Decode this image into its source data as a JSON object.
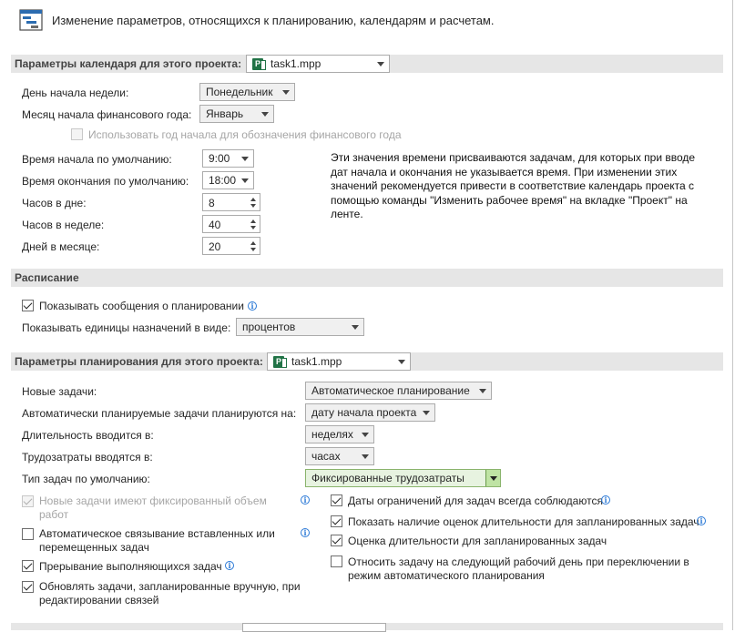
{
  "header": {
    "text": "Изменение параметров, относящихся к планированию, календарям и расчетам.",
    "icon": "schedule-icon"
  },
  "calendar": {
    "title": "Параметры календаря для этого проекта:",
    "project": "task1.mpp",
    "week_start_label": "День начала недели:",
    "week_start_value": "Понедельник",
    "fiscal_label": "Месяц начала финансового года:",
    "fiscal_value": "Январь",
    "fiscal_checkbox_label": "Использовать год начала для обозначения финансового года",
    "start_time_label": "Время начала по умолчанию:",
    "start_time_value": "9:00",
    "end_time_label": "Время окончания по умолчанию:",
    "end_time_value": "18:00",
    "hours_day_label": "Часов в дне:",
    "hours_day_value": "8",
    "hours_week_label": "Часов в неделе:",
    "hours_week_value": "40",
    "days_month_label": "Дней в месяце:",
    "days_month_value": "20",
    "note": "Эти значения времени присваиваются задачам, для которых при вводе дат начала и окончания не указывается время. При изменении этих значений рекомендуется привести в соответствие календарь проекта с помощью команды \"Изменить рабочее время\" на вкладке \"Проект\" на ленте."
  },
  "schedule": {
    "title": "Расписание",
    "show_messages_label": "Показывать сообщения о планировании",
    "show_messages_checked": true,
    "units_label": "Показывать единицы назначений в виде:",
    "units_value": "процентов"
  },
  "planning": {
    "title": "Параметры планирования для этого проекта:",
    "project": "task1.mpp",
    "new_tasks_label": "Новые задачи:",
    "new_tasks_value": "Автоматическое планирование",
    "auto_tasks_label": "Автоматически планируемые задачи планируются на:",
    "auto_tasks_value": "дату начала проекта",
    "duration_label": "Длительность вводится в:",
    "duration_value": "неделях",
    "work_label": "Трудозатраты вводятся в:",
    "work_value": "часах",
    "task_type_label": "Тип задач по умолчанию:",
    "task_type_value": "Фиксированные трудозатраты",
    "left_options": [
      {
        "label": "Новые задачи имеют фиксированный объем работ",
        "checked": true,
        "disabled": true
      },
      {
        "label": "Автоматическое связывание вставленных или перемещенных задач",
        "checked": false,
        "disabled": false
      },
      {
        "label": "Прерывание выполняющихся задач",
        "checked": true,
        "disabled": false
      },
      {
        "label": "Обновлять задачи, запланированные вручную, при редактировании связей",
        "checked": true,
        "disabled": false
      }
    ],
    "right_options": [
      {
        "label": "Даты ограничений для задач всегда соблюдаются",
        "checked": true
      },
      {
        "label": "Показать наличие оценок длительности для запланированных задач",
        "checked": true
      },
      {
        "label": "Оценка длительности для запланированных задач",
        "checked": true
      },
      {
        "label": "Относить задачу на следующий рабочий день при переключении в режим автоматического планирования",
        "checked": false
      }
    ]
  },
  "bottom": {
    "title": "",
    "project": ""
  },
  "colors": {
    "band": "#e6e6e6",
    "accent_green": "#bfe3a4",
    "info_blue": "#2b79d6"
  }
}
